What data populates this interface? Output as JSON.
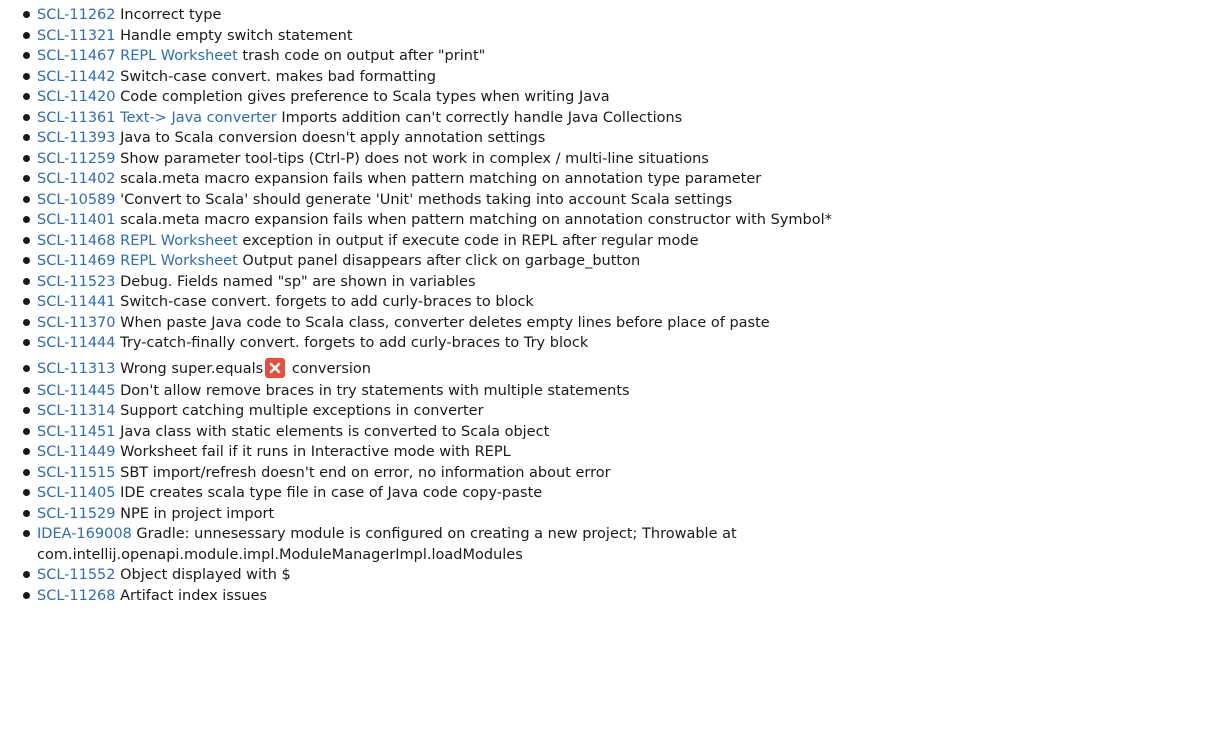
{
  "issues": [
    {
      "key": "SCL-11262",
      "tag": "",
      "title": "Incorrect type"
    },
    {
      "key": "SCL-11321",
      "tag": "",
      "title": "Handle empty switch statement"
    },
    {
      "key": "SCL-11467",
      "tag": "REPL Worksheet",
      "title": "trash code on output after \"print\""
    },
    {
      "key": "SCL-11442",
      "tag": "",
      "title": "Switch-case convert. makes bad formatting"
    },
    {
      "key": "SCL-11420",
      "tag": "",
      "title": "Code completion gives preference to Scala types when writing Java"
    },
    {
      "key": "SCL-11361",
      "tag": "Text-> Java converter",
      "title": "Imports addition can't correctly handle Java Collections"
    },
    {
      "key": "SCL-11393",
      "tag": "",
      "title": "Java to Scala conversion doesn't apply annotation settings"
    },
    {
      "key": "SCL-11259",
      "tag": "",
      "title": "Show parameter tool-tips (Ctrl-P) does not work in complex / multi-line situations"
    },
    {
      "key": "SCL-11402",
      "tag": "",
      "title": "scala.meta macro expansion fails when pattern matching on annotation type parameter"
    },
    {
      "key": "SCL-10589",
      "tag": "",
      "title": "'Convert to Scala' should generate 'Unit' methods taking into account Scala settings"
    },
    {
      "key": "SCL-11401",
      "tag": "",
      "title": "scala.meta macro expansion fails when pattern matching on annotation constructor with Symbol*"
    },
    {
      "key": "SCL-11468",
      "tag": "REPL Worksheet",
      "title": "exception in output if execute code in REPL after regular mode"
    },
    {
      "key": "SCL-11469",
      "tag": "REPL Worksheet",
      "title": "Output panel disappears after click on garbage_button"
    },
    {
      "key": "SCL-11523",
      "tag": "",
      "title": "Debug. Fields named \"sp\" are shown in variables"
    },
    {
      "key": "SCL-11441",
      "tag": "",
      "title": "Switch-case convert. forgets to add curly-braces to block"
    },
    {
      "key": "SCL-11370",
      "tag": "",
      "title": "When paste Java code to Scala class, converter deletes empty lines before place of paste"
    },
    {
      "key": "SCL-11444",
      "tag": "",
      "title": "Try-catch-finally convert. forgets to add curly-braces to Try block"
    },
    {
      "key": "SCL-11313",
      "tag": "",
      "title": "Wrong super.equals",
      "title_after": "conversion",
      "icon": "error-x-icon"
    },
    {
      "key": "SCL-11445",
      "tag": "",
      "title": "Don't allow remove braces in try statements with multiple statements"
    },
    {
      "key": "SCL-11314",
      "tag": "",
      "title": "Support catching multiple exceptions in converter"
    },
    {
      "key": "SCL-11451",
      "tag": "",
      "title": "Java class with static elements is converted to Scala object"
    },
    {
      "key": "SCL-11449",
      "tag": "",
      "title": "Worksheet fail if it runs in Interactive mode with REPL"
    },
    {
      "key": "SCL-11515",
      "tag": "",
      "title": "SBT import/refresh doesn't end on error, no information about error"
    },
    {
      "key": "SCL-11405",
      "tag": "",
      "title": "IDE creates scala type file in case of Java code copy-paste"
    },
    {
      "key": "SCL-11529",
      "tag": "",
      "title": "NPE in project import"
    },
    {
      "key": "IDEA-169008",
      "tag": "",
      "title": "Gradle: unnesessary module is configured on creating a new project; Throwable at com.intellij.openapi.module.impl.ModuleManagerImpl.loadModules"
    },
    {
      "key": "SCL-11552",
      "tag": "",
      "title": "Object displayed with $"
    },
    {
      "key": "SCL-11268",
      "tag": "",
      "title": "Artifact index issues"
    }
  ],
  "colors": {
    "link": "#2a6db8",
    "text": "#1a1a1a",
    "error_icon": "#e84c3d"
  }
}
